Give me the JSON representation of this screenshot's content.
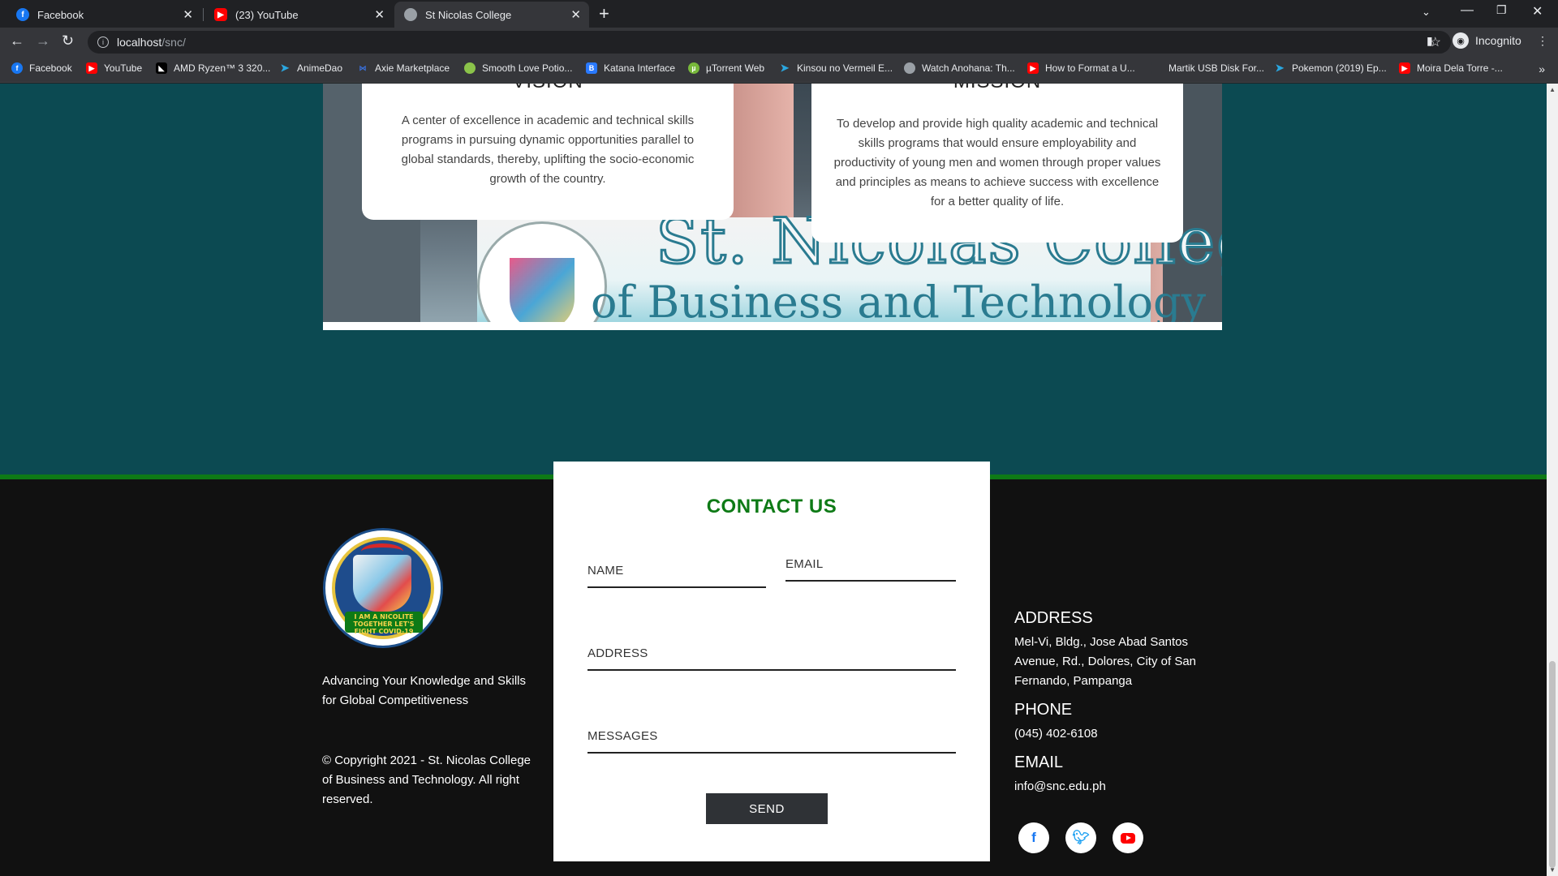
{
  "browser": {
    "tabs": [
      {
        "title": "Facebook",
        "favicon": "facebook-icon",
        "color": "#1877f2"
      },
      {
        "title": "(23) YouTube",
        "favicon": "youtube-icon",
        "color": "#ff0000"
      },
      {
        "title": "St Nicolas College",
        "favicon": "college-seal-icon",
        "color": "#9aa0a6"
      }
    ],
    "address_host": "localhost",
    "address_path": "/snc/",
    "profile_label": "Incognito",
    "bookmarks": [
      {
        "label": "Facebook",
        "icon": "facebook-icon",
        "color": "#1877f2"
      },
      {
        "label": "YouTube",
        "icon": "youtube-icon",
        "color": "#ff0000"
      },
      {
        "label": "AMD Ryzen™ 3 320...",
        "icon": "amd-icon",
        "color": "#000000"
      },
      {
        "label": "AnimeDao",
        "icon": "send-icon",
        "color": "#2aa7e0"
      },
      {
        "label": "Axie Marketplace",
        "icon": "axie-icon",
        "color": "#3a6fd8"
      },
      {
        "label": "Smooth Love Potio...",
        "icon": "potion-icon",
        "color": "#8bc34a"
      },
      {
        "label": "Katana Interface",
        "icon": "katana-icon",
        "color": "#2979ff"
      },
      {
        "label": "µTorrent Web",
        "icon": "utorrent-icon",
        "color": "#78b83b"
      },
      {
        "label": "Kinsou no Vermeil E...",
        "icon": "send-icon",
        "color": "#2aa7e0"
      },
      {
        "label": "Watch Anohana: Th...",
        "icon": "globe-icon",
        "color": "#9aa0a6"
      },
      {
        "label": "How to Format a U...",
        "icon": "youtube-icon",
        "color": "#ff0000"
      },
      {
        "label": "Martik USB Disk For...",
        "icon": "blank-page-icon",
        "color": "#35363a"
      },
      {
        "label": "Pokemon (2019) Ep...",
        "icon": "send-icon",
        "color": "#2aa7e0"
      },
      {
        "label": "Moira Dela Torre -...",
        "icon": "youtube-icon",
        "color": "#ff0000"
      }
    ]
  },
  "hero": {
    "sign_line1": "St. Nicolas College",
    "sign_line2": "of Business and Technology"
  },
  "vision": {
    "heading": "VISION",
    "text": "A center of excellence in academic and technical skills programs in pursuing dynamic opportunities parallel to global standards, thereby, uplifting the socio-economic growth of the country."
  },
  "mission": {
    "heading": "MISSION",
    "text": "To develop and provide high quality academic and technical skills programs that would ensure employability and productivity of young men and women through proper values and principles as means to achieve success with excellence for a better quality of life."
  },
  "footer": {
    "logo_banner": "I AM A NICOLITE TOGETHER LET'S FIGHT COVID-19",
    "tagline": "Advancing Your Knowledge and Skills for Global Competitiveness",
    "copyright": "© Copyright 2021 - St. Nicolas College of Business and Technology. All right reserved.",
    "contact": {
      "title": "CONTACT US",
      "name_placeholder": "NAME",
      "email_placeholder": "EMAIL",
      "address_placeholder": "ADDRESS",
      "messages_placeholder": "MESSAGES",
      "send_label": "SEND"
    },
    "address_heading": "ADDRESS",
    "address": "Mel-Vi, Bldg., Jose Abad Santos Avenue, Rd., Dolores, City of San Fernando, Pampanga",
    "phone_heading": "PHONE",
    "phone": "(045) 402-6108",
    "email_heading": "EMAIL",
    "email": "info@snc.edu.ph"
  },
  "colors": {
    "accent_green": "#0e7a16",
    "page_teal": "#0c4a52",
    "footer_bg": "#111111"
  }
}
